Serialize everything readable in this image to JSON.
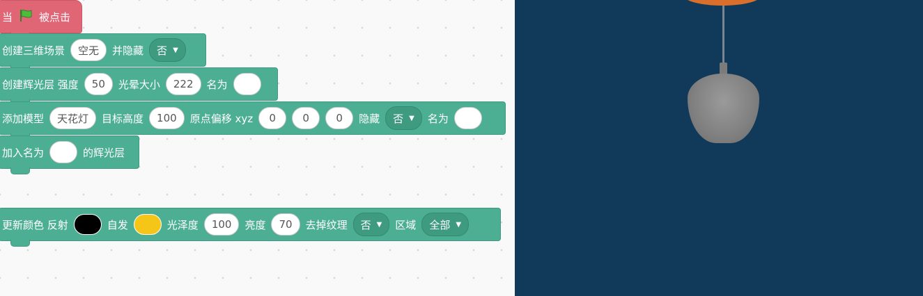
{
  "hat_block": {
    "prefix": "当",
    "suffix": "被点击",
    "flag_icon": "green-flag-icon"
  },
  "block1": {
    "label": "创建三维场景",
    "scene_value": "空无",
    "hide_label": "并隐藏",
    "hide_value": "否"
  },
  "block2": {
    "label": "创建辉光层 强度",
    "strength": "50",
    "halo_label": "光晕大小",
    "halo_value": "222",
    "name_label": "名为",
    "name_value": ""
  },
  "block3": {
    "label": "添加模型",
    "model": "天花灯",
    "height_label": "目标高度",
    "height": "100",
    "offset_label": "原点偏移 xyz",
    "x": "0",
    "y": "0",
    "z": "0",
    "hide_label": "隐藏",
    "hide_value": "否",
    "name_label": "名为",
    "name_value": ""
  },
  "block4": {
    "label": "加入名为",
    "name_value": "",
    "suffix": "的辉光层"
  },
  "block5": {
    "label": "更新颜色 反射",
    "reflect_color": "#000000",
    "emit_label": "自发",
    "emit_color": "#f5c518",
    "gloss_label": "光泽度",
    "gloss": "100",
    "bright_label": "亮度",
    "bright": "70",
    "texture_label": "去掉纹理",
    "texture_value": "否",
    "region_label": "区域",
    "region_value": "全部"
  },
  "colors": {
    "block_green": "#4caf93",
    "hat_red": "#e06676",
    "stage_bg": "#113a5a",
    "lamp_orange": "#d96f2b"
  }
}
